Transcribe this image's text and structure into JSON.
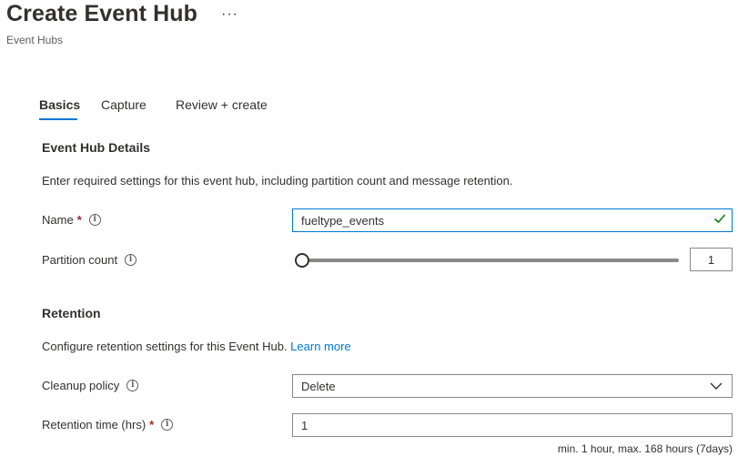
{
  "header": {
    "title": "Create Event Hub",
    "more_label": "···",
    "subtitle": "Event Hubs"
  },
  "tabs": [
    {
      "label": "Basics",
      "active": true
    },
    {
      "label": "Capture",
      "active": false
    },
    {
      "label": "Review + create",
      "active": false
    }
  ],
  "details": {
    "title": "Event Hub Details",
    "description": "Enter required settings for this event hub, including partition count and message retention.",
    "name": {
      "label": "Name",
      "required_mark": "*",
      "value": "fueltype_events"
    },
    "partition": {
      "label": "Partition count",
      "value": "1",
      "slider_fraction": 0
    }
  },
  "retention": {
    "title": "Retention",
    "description": "Configure retention settings for this Event Hub.",
    "learn_more": "Learn more",
    "cleanup": {
      "label": "Cleanup policy",
      "value": "Delete"
    },
    "time": {
      "label": "Retention time (hrs)",
      "required_mark": "*",
      "value": "1",
      "hint": "min. 1 hour, max. 168 hours (7days)"
    }
  },
  "colors": {
    "accent": "#0078d4",
    "valid": "#107c10",
    "required": "#a4262c"
  }
}
